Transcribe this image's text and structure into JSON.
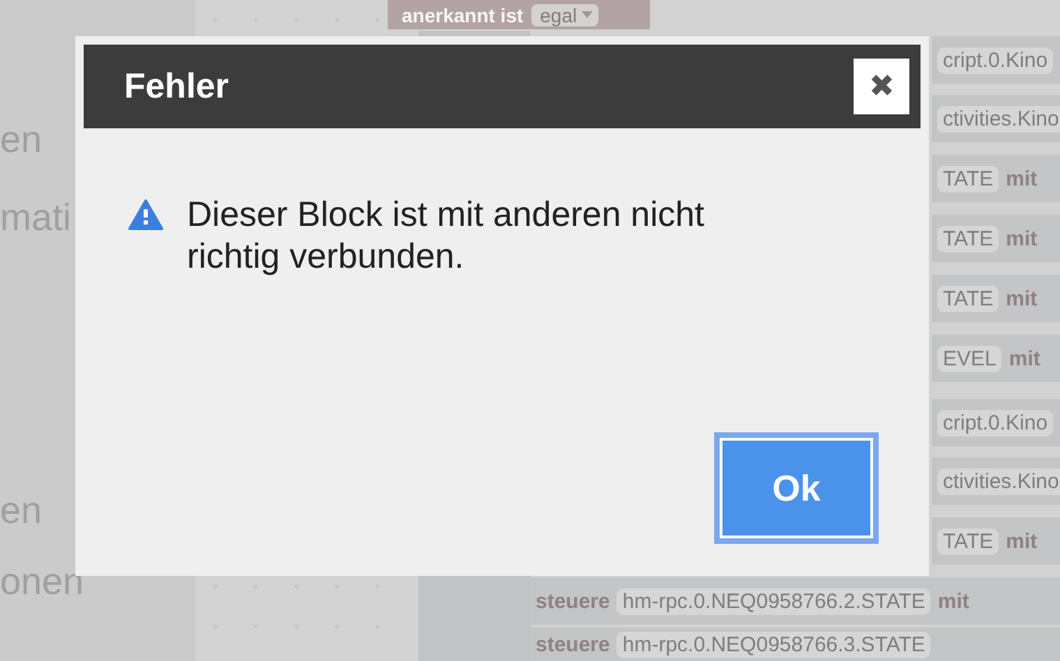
{
  "background": {
    "sidebar_texts": [
      "en",
      "mati",
      "en",
      "onen"
    ],
    "header_block": {
      "label": "anerkannt ist",
      "dropdown": "egal"
    },
    "canvas_rows": [
      {
        "items": [
          {
            "kind": "field",
            "text": "cript.0.Kino"
          }
        ]
      },
      {
        "items": [
          {
            "kind": "field",
            "text": "ctivities.Kino"
          }
        ]
      },
      {
        "items": [
          {
            "kind": "field",
            "text": "TATE"
          },
          {
            "kind": "keyword",
            "text": "mit"
          }
        ]
      },
      {
        "items": [
          {
            "kind": "field",
            "text": "TATE"
          },
          {
            "kind": "keyword",
            "text": "mit"
          }
        ]
      },
      {
        "items": [
          {
            "kind": "field",
            "text": "TATE"
          },
          {
            "kind": "keyword",
            "text": "mit"
          }
        ]
      },
      {
        "items": [
          {
            "kind": "field",
            "text": "EVEL"
          },
          {
            "kind": "keyword",
            "text": "mit"
          }
        ]
      },
      {
        "items": [
          {
            "kind": "field",
            "text": "cript.0.Kino"
          }
        ]
      },
      {
        "items": [
          {
            "kind": "field",
            "text": "ctivities.Kino"
          }
        ]
      },
      {
        "items": [
          {
            "kind": "field",
            "text": "TATE"
          },
          {
            "kind": "keyword",
            "text": "mit"
          }
        ]
      },
      {
        "items": [
          {
            "kind": "keyword",
            "text": "steuere"
          },
          {
            "kind": "field",
            "text": "hm-rpc.0.NEQ0958766.2.STATE"
          },
          {
            "kind": "keyword",
            "text": "mit"
          }
        ]
      },
      {
        "items": [
          {
            "kind": "keyword",
            "text": "steuere"
          },
          {
            "kind": "field",
            "text": "hm-rpc.0.NEQ0958766.3.STATE"
          }
        ]
      }
    ]
  },
  "dialog": {
    "title": "Fehler",
    "close": "✖",
    "message": "Dieser Block ist mit anderen nicht richtig verbunden.",
    "buttons": [
      {
        "label": "Ok",
        "focused": true
      }
    ]
  }
}
